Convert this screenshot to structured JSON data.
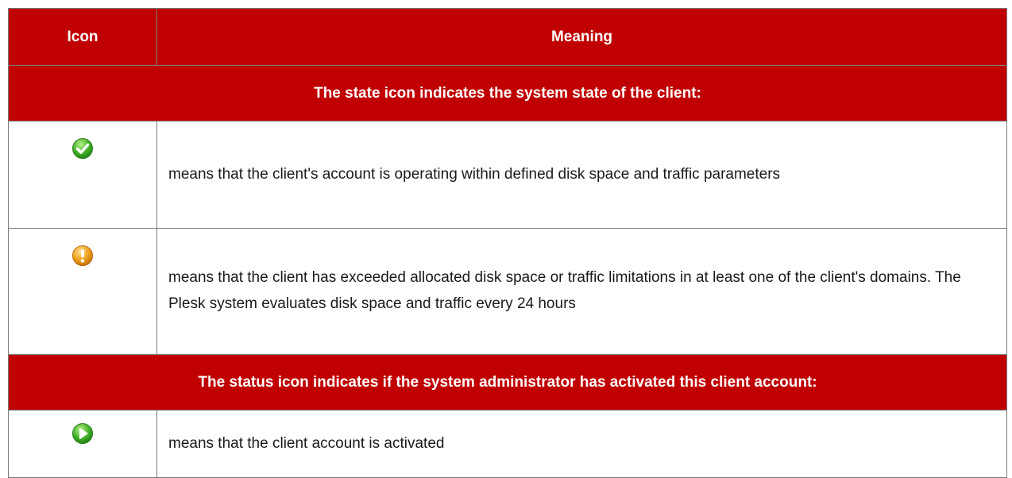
{
  "header": {
    "icon_col": "Icon",
    "meaning_col": "Meaning"
  },
  "sections": [
    {
      "title": "The state icon indicates the system state of the client:",
      "rows": [
        {
          "icon": "check-circle-icon",
          "meaning": "means that the client's account is operating within defined disk space and traffic parameters"
        },
        {
          "icon": "warning-exclamation-icon",
          "meaning": "means that the client has exceeded allocated disk space or traffic limitations in at least one of the client's domains. The Plesk system evaluates disk space and traffic every 24 hours"
        }
      ]
    },
    {
      "title": "The status icon indicates if the system administrator has activated this client account:",
      "rows": [
        {
          "icon": "play-activated-icon",
          "meaning": "means that the client account is activated"
        }
      ]
    }
  ],
  "colors": {
    "header_bg": "#c00000",
    "header_text": "#ffffff",
    "border": "#7a7a7a"
  }
}
